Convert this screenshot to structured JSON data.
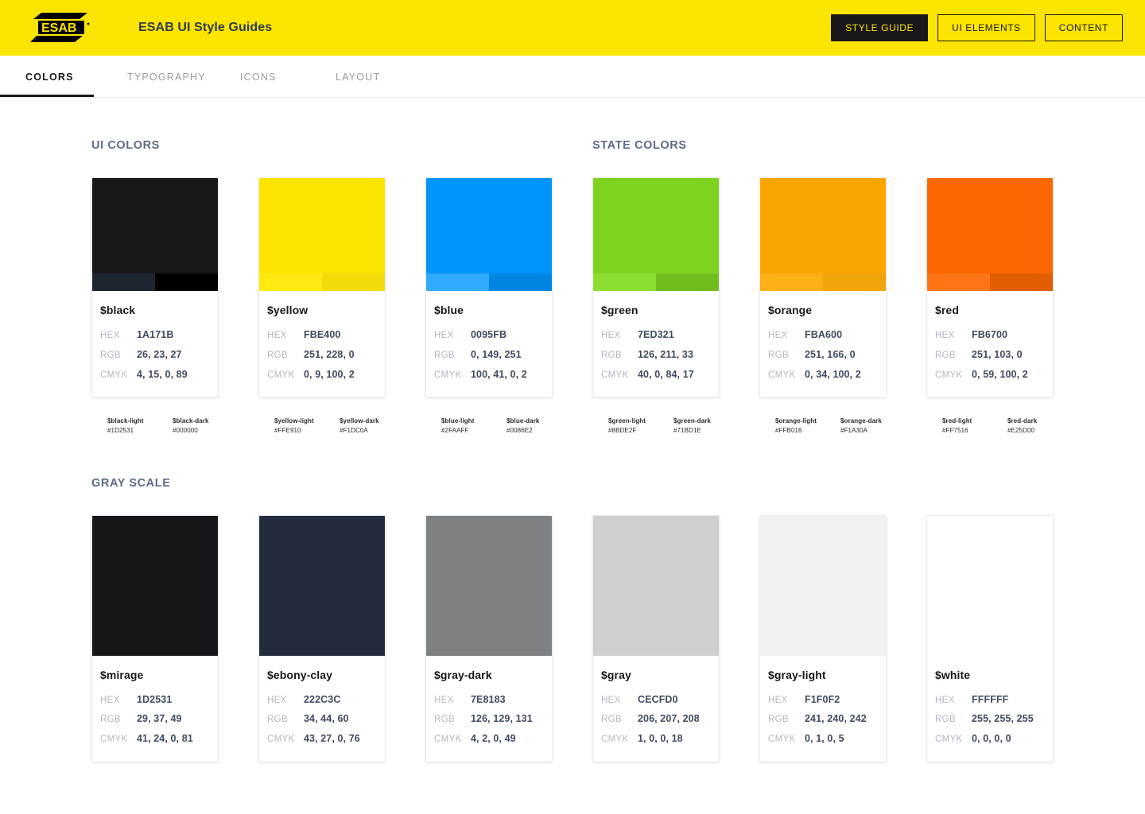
{
  "header": {
    "logo_icon": "esab-logo-icon",
    "logo_text": "ESAB",
    "registered_mark": "®",
    "title": "ESAB UI Style Guides",
    "background": "#FBE400",
    "buttons": [
      {
        "label": "STYLE GUIDE",
        "active": true
      },
      {
        "label": "UI ELEMENTS",
        "active": false
      },
      {
        "label": "CONTENT",
        "active": false
      }
    ]
  },
  "tabs": {
    "active_index": 0,
    "items": [
      {
        "label": "COLORS"
      },
      {
        "label": "TYPOGRAPHY"
      },
      {
        "label": "ICONS"
      },
      {
        "label": "LAYOUT"
      }
    ]
  },
  "sections": [
    {
      "id": "ui-colors",
      "title": "UI COLORS",
      "has_variants": true,
      "cards": [
        {
          "name": "$black",
          "swatch": "#1A171B",
          "light": "#1D2531",
          "dark": "#000000",
          "hex_label": "HEX",
          "hex": "1A171B",
          "rgb_label": "RGB",
          "rgb": "26, 23, 27",
          "cmyk_label": "CMYK",
          "cmyk": "4, 15, 0, 89",
          "variants": [
            {
              "name": "$black-light",
              "hex": "#1D2531"
            },
            {
              "name": "$black-dark",
              "hex": "#000000"
            }
          ]
        },
        {
          "name": "$yellow",
          "swatch": "#FBE400",
          "light": "#FFE910",
          "dark": "#F1DC0A",
          "hex_label": "HEX",
          "hex": "FBE400",
          "rgb_label": "RGB",
          "rgb": "251, 228, 0",
          "cmyk_label": "CMYK",
          "cmyk": "0, 9, 100, 2",
          "variants": [
            {
              "name": "$yellow-light",
              "hex": "#FFE910"
            },
            {
              "name": "$yellow-dark",
              "hex": "#F1DC0A"
            }
          ]
        },
        {
          "name": "$blue",
          "swatch": "#0095FB",
          "light": "#2FAAFF",
          "dark": "#0086E2",
          "hex_label": "HEX",
          "hex": "0095FB",
          "rgb_label": "RGB",
          "rgb": "0, 149, 251",
          "cmyk_label": "CMYK",
          "cmyk": "100, 41, 0, 2",
          "variants": [
            {
              "name": "$blue-light",
              "hex": "#2FAAFF"
            },
            {
              "name": "$blue-dark",
              "hex": "#0086E2"
            }
          ]
        }
      ]
    },
    {
      "id": "state-colors",
      "title": "STATE COLORS",
      "has_variants": true,
      "cards": [
        {
          "name": "$green",
          "swatch": "#7ED321",
          "light": "#8BDE2F",
          "dark": "#71BD1E",
          "hex_label": "HEX",
          "hex": "7ED321",
          "rgb_label": "RGB",
          "rgb": "126, 211, 33",
          "cmyk_label": "CMYK",
          "cmyk": "40, 0, 84, 17",
          "variants": [
            {
              "name": "$green-light",
              "hex": "#8BDE2F"
            },
            {
              "name": "$green-dark",
              "hex": "#71BD1E"
            }
          ]
        },
        {
          "name": "$orange",
          "swatch": "#FBA600",
          "light": "#FFB016",
          "dark": "#F1A30A",
          "hex_label": "HEX",
          "hex": "FBA600",
          "rgb_label": "RGB",
          "rgb": "251, 166, 0",
          "cmyk_label": "CMYK",
          "cmyk": "0, 34, 100, 2",
          "variants": [
            {
              "name": "$orange-light",
              "hex": "#FFB016"
            },
            {
              "name": "$orange-dark",
              "hex": "#F1A30A"
            }
          ]
        },
        {
          "name": "$red",
          "swatch": "#FB6700",
          "light": "#FF7516",
          "dark": "#E25D00",
          "hex_label": "HEX",
          "hex": "FB6700",
          "rgb_label": "RGB",
          "rgb": "251, 103, 0",
          "cmyk_label": "CMYK",
          "cmyk": "0, 59, 100, 2",
          "variants": [
            {
              "name": "$red-light",
              "hex": "#FF7516"
            },
            {
              "name": "$red-dark",
              "hex": "#E25D00"
            }
          ]
        }
      ]
    },
    {
      "id": "gray-scale",
      "title": "GRAY SCALE",
      "has_variants": false,
      "cards": [
        {
          "name": "$mirage",
          "swatch": "#17161A",
          "hex_label": "HEX",
          "hex": "1D2531",
          "rgb_label": "RGB",
          "rgb": "29, 37, 49",
          "cmyk_label": "CMYK",
          "cmyk": "41, 24, 0, 81"
        },
        {
          "name": "$ebony-clay",
          "swatch": "#222C3C",
          "hex_label": "HEX",
          "hex": "222C3C",
          "rgb_label": "RGB",
          "rgb": "34, 44, 60",
          "cmyk_label": "CMYK",
          "cmyk": "43, 27, 0, 76"
        },
        {
          "name": "$gray-dark",
          "swatch": "#7E8183",
          "hex_label": "HEX",
          "hex": "7E8183",
          "rgb_label": "RGB",
          "rgb": "126, 129, 131",
          "cmyk_label": "CMYK",
          "cmyk": "4, 2, 0, 49"
        },
        {
          "name": "$gray",
          "swatch": "#CECFD0",
          "hex_label": "HEX",
          "hex": "CECFD0",
          "rgb_label": "RGB",
          "rgb": "206, 207, 208",
          "cmyk_label": "CMYK",
          "cmyk": "1, 0, 0, 18"
        },
        {
          "name": "$gray-light",
          "swatch": "#F1F0F2",
          "hex_label": "HEX",
          "hex": "F1F0F2",
          "rgb_label": "RGB",
          "rgb": "241, 240, 242",
          "cmyk_label": "CMYK",
          "cmyk": "0, 1, 0, 5"
        },
        {
          "name": "$white",
          "swatch": "#FFFFFF",
          "hex_label": "HEX",
          "hex": "FFFFFF",
          "rgb_label": "RGB",
          "rgb": "255, 255, 255",
          "cmyk_label": "CMYK",
          "cmyk": "0, 0, 0, 0"
        }
      ]
    }
  ]
}
